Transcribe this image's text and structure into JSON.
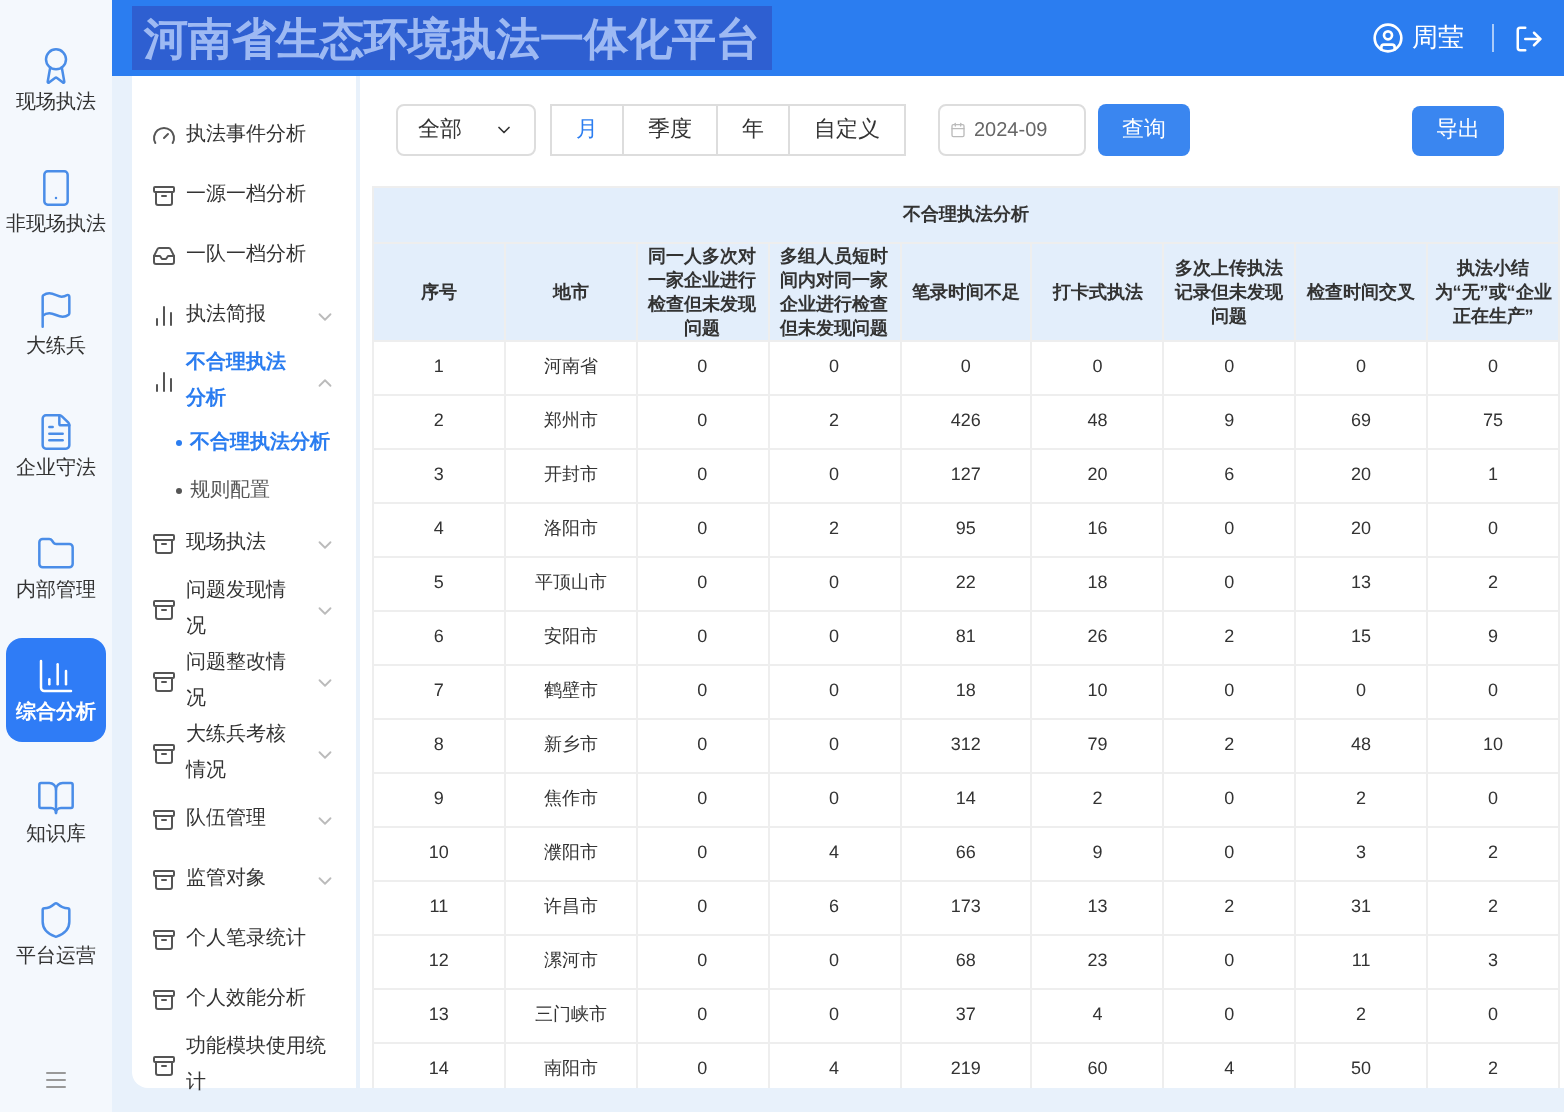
{
  "header": {
    "title": "河南省生态环境执法一体化平台",
    "user": "周莹"
  },
  "rail": [
    {
      "label": "现场执法",
      "selected": false
    },
    {
      "label": "非现场执法",
      "selected": false
    },
    {
      "label": "大练兵",
      "selected": false
    },
    {
      "label": "企业守法",
      "selected": false
    },
    {
      "label": "内部管理",
      "selected": false
    },
    {
      "label": "综合分析",
      "selected": true
    },
    {
      "label": "知识库",
      "selected": false
    },
    {
      "label": "平台运营",
      "selected": false
    }
  ],
  "menu": [
    {
      "label": "执法事件分析",
      "selected": false
    },
    {
      "label": "一源一档分析",
      "selected": false
    },
    {
      "label": "一队一档分析",
      "selected": false
    },
    {
      "label": "执法简报",
      "selected": false,
      "expanded": false
    },
    {
      "label": "不合理执法分析",
      "selected": true,
      "expanded": true,
      "children": [
        {
          "label": "不合理执法分析",
          "selected": true
        },
        {
          "label": "规则配置",
          "selected": false
        }
      ]
    },
    {
      "label": "现场执法",
      "selected": false,
      "expanded": false
    },
    {
      "label": "问题发现情况",
      "selected": false,
      "expanded": false
    },
    {
      "label": "问题整改情况",
      "selected": false,
      "expanded": false
    },
    {
      "label": "大练兵考核情况",
      "selected": false,
      "expanded": false
    },
    {
      "label": "队伍管理",
      "selected": false,
      "expanded": false
    },
    {
      "label": "监管对象",
      "selected": false,
      "expanded": false
    },
    {
      "label": "个人笔录统计",
      "selected": false
    },
    {
      "label": "个人效能分析",
      "selected": false
    },
    {
      "label": "功能模块使用统计",
      "selected": false
    }
  ],
  "toolbar": {
    "scope": "全部",
    "periods": [
      {
        "label": "月",
        "selected": true
      },
      {
        "label": "季度",
        "selected": false
      },
      {
        "label": "年",
        "selected": false
      },
      {
        "label": "自定义",
        "selected": false
      }
    ],
    "date": "2024-09",
    "query": "查询",
    "export": "导出"
  },
  "table": {
    "title": "不合理执法分析",
    "columns": [
      "序号",
      "地市",
      "同一人多次对一家企业进行检查但未发现问题",
      "多组人员短时间内对同一家企业进行检查但未发现问题",
      "笔录时间不足",
      "打卡式执法",
      "多次上传执法记录但未发现问题",
      "检查时间交叉",
      "执法小结为“无”或“企业正在生产”"
    ],
    "rows": [
      [
        "1",
        "河南省",
        "0",
        "0",
        "0",
        "0",
        "0",
        "0",
        "0"
      ],
      [
        "2",
        "郑州市",
        "0",
        "2",
        "426",
        "48",
        "9",
        "69",
        "75"
      ],
      [
        "3",
        "开封市",
        "0",
        "0",
        "127",
        "20",
        "6",
        "20",
        "1"
      ],
      [
        "4",
        "洛阳市",
        "0",
        "2",
        "95",
        "16",
        "0",
        "20",
        "0"
      ],
      [
        "5",
        "平顶山市",
        "0",
        "0",
        "22",
        "18",
        "0",
        "13",
        "2"
      ],
      [
        "6",
        "安阳市",
        "0",
        "0",
        "81",
        "26",
        "2",
        "15",
        "9"
      ],
      [
        "7",
        "鹤壁市",
        "0",
        "0",
        "18",
        "10",
        "0",
        "0",
        "0"
      ],
      [
        "8",
        "新乡市",
        "0",
        "0",
        "312",
        "79",
        "2",
        "48",
        "10"
      ],
      [
        "9",
        "焦作市",
        "0",
        "0",
        "14",
        "2",
        "0",
        "2",
        "0"
      ],
      [
        "10",
        "濮阳市",
        "0",
        "4",
        "66",
        "9",
        "0",
        "3",
        "2"
      ],
      [
        "11",
        "许昌市",
        "0",
        "6",
        "173",
        "13",
        "2",
        "31",
        "2"
      ],
      [
        "12",
        "漯河市",
        "0",
        "0",
        "68",
        "23",
        "0",
        "11",
        "3"
      ],
      [
        "13",
        "三门峡市",
        "0",
        "0",
        "37",
        "4",
        "0",
        "2",
        "0"
      ],
      [
        "14",
        "南阳市",
        "0",
        "4",
        "219",
        "60",
        "4",
        "50",
        "2"
      ]
    ]
  }
}
